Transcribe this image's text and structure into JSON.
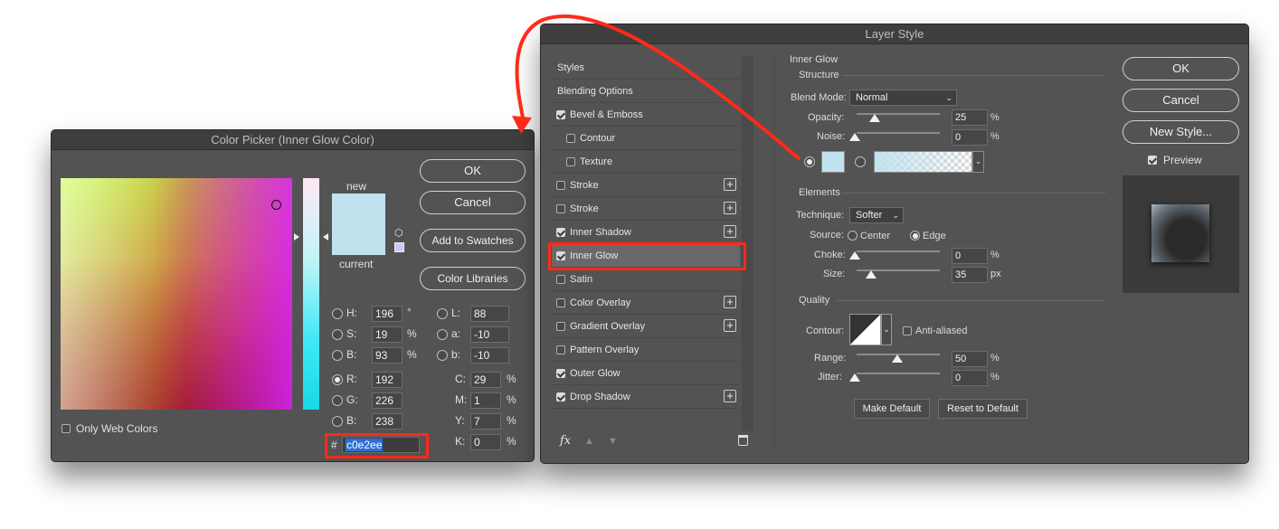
{
  "picker": {
    "title": "Color Picker (Inner Glow Color)",
    "new_label": "new",
    "current_label": "current",
    "ok": "OK",
    "cancel": "Cancel",
    "add_swatches": "Add to Swatches",
    "color_libraries": "Color Libraries",
    "only_web": "Only Web Colors",
    "hex_prefix": "#",
    "hex": "c0e2ee",
    "new_color": "#c0e2ee",
    "current_color": "#c0e2ee",
    "hsb": [
      {
        "label": "H:",
        "value": "196",
        "unit": "°"
      },
      {
        "label": "S:",
        "value": "19",
        "unit": "%"
      },
      {
        "label": "B:",
        "value": "93",
        "unit": "%"
      }
    ],
    "lab": [
      {
        "label": "L:",
        "value": "88"
      },
      {
        "label": "a:",
        "value": "-10"
      },
      {
        "label": "b:",
        "value": "-10"
      }
    ],
    "rgb": [
      {
        "label": "R:",
        "value": "192"
      },
      {
        "label": "G:",
        "value": "226"
      },
      {
        "label": "B:",
        "value": "238"
      }
    ],
    "cmyk": [
      {
        "label": "C:",
        "value": "29",
        "unit": "%"
      },
      {
        "label": "M:",
        "value": "1",
        "unit": "%"
      },
      {
        "label": "Y:",
        "value": "7",
        "unit": "%"
      },
      {
        "label": "K:",
        "value": "0",
        "unit": "%"
      }
    ]
  },
  "layer": {
    "title": "Layer Style",
    "ok": "OK",
    "cancel": "Cancel",
    "new_style": "New Style...",
    "preview": "Preview",
    "list": [
      {
        "label": "Styles"
      },
      {
        "label": "Blending Options"
      },
      {
        "label": "Bevel & Emboss",
        "checked": true
      },
      {
        "label": "Contour",
        "sub": true
      },
      {
        "label": "Texture",
        "sub": true
      },
      {
        "label": "Stroke",
        "plus": true
      },
      {
        "label": "Stroke",
        "plus": true
      },
      {
        "label": "Inner Shadow",
        "checked": true,
        "plus": true
      },
      {
        "label": "Inner Glow",
        "checked": true,
        "selected": true
      },
      {
        "label": "Satin"
      },
      {
        "label": "Color Overlay",
        "plus": true
      },
      {
        "label": "Gradient Overlay",
        "plus": true
      },
      {
        "label": "Pattern Overlay"
      },
      {
        "label": "Outer Glow",
        "checked": true
      },
      {
        "label": "Drop Shadow",
        "checked": true,
        "plus": true
      }
    ],
    "fx": "fx",
    "inner_glow": "Inner Glow",
    "structure": "Structure",
    "blend_mode_label": "Blend Mode:",
    "blend_mode": "Normal",
    "opacity_label": "Opacity:",
    "opacity": "25",
    "noise_label": "Noise:",
    "noise": "0",
    "pct": "%",
    "elements": "Elements",
    "technique_label": "Technique:",
    "technique": "Softer",
    "source_label": "Source:",
    "center": "Center",
    "edge": "Edge",
    "choke_label": "Choke:",
    "choke": "0",
    "size_label": "Size:",
    "size": "35",
    "px": "px",
    "quality": "Quality",
    "contour_label": "Contour:",
    "anti_aliased": "Anti-aliased",
    "range_label": "Range:",
    "range": "50",
    "jitter_label": "Jitter:",
    "jitter": "0",
    "make_default": "Make Default",
    "reset_default": "Reset to Default"
  },
  "colors": {
    "accent_red": "#ff2a1a",
    "glow": "#c0e2ee"
  }
}
